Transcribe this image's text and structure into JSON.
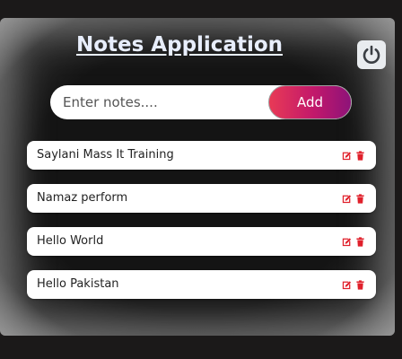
{
  "app": {
    "title": "Notes Application"
  },
  "header": {
    "power_icon": "power-icon"
  },
  "form": {
    "placeholder": "Enter notes....",
    "value": "",
    "add_label": "Add"
  },
  "notes": [
    {
      "text": "Saylani Mass It Training"
    },
    {
      "text": "Namaz perform"
    },
    {
      "text": "Hello World"
    },
    {
      "text": "Hello Pakistan"
    }
  ],
  "icons": {
    "edit": "edit-icon",
    "delete": "trash-icon"
  },
  "colors": {
    "accent_start": "#e83a56",
    "accent_end": "#8d1379",
    "icon_red": "#e0202b",
    "title_color": "#e8eefc"
  }
}
